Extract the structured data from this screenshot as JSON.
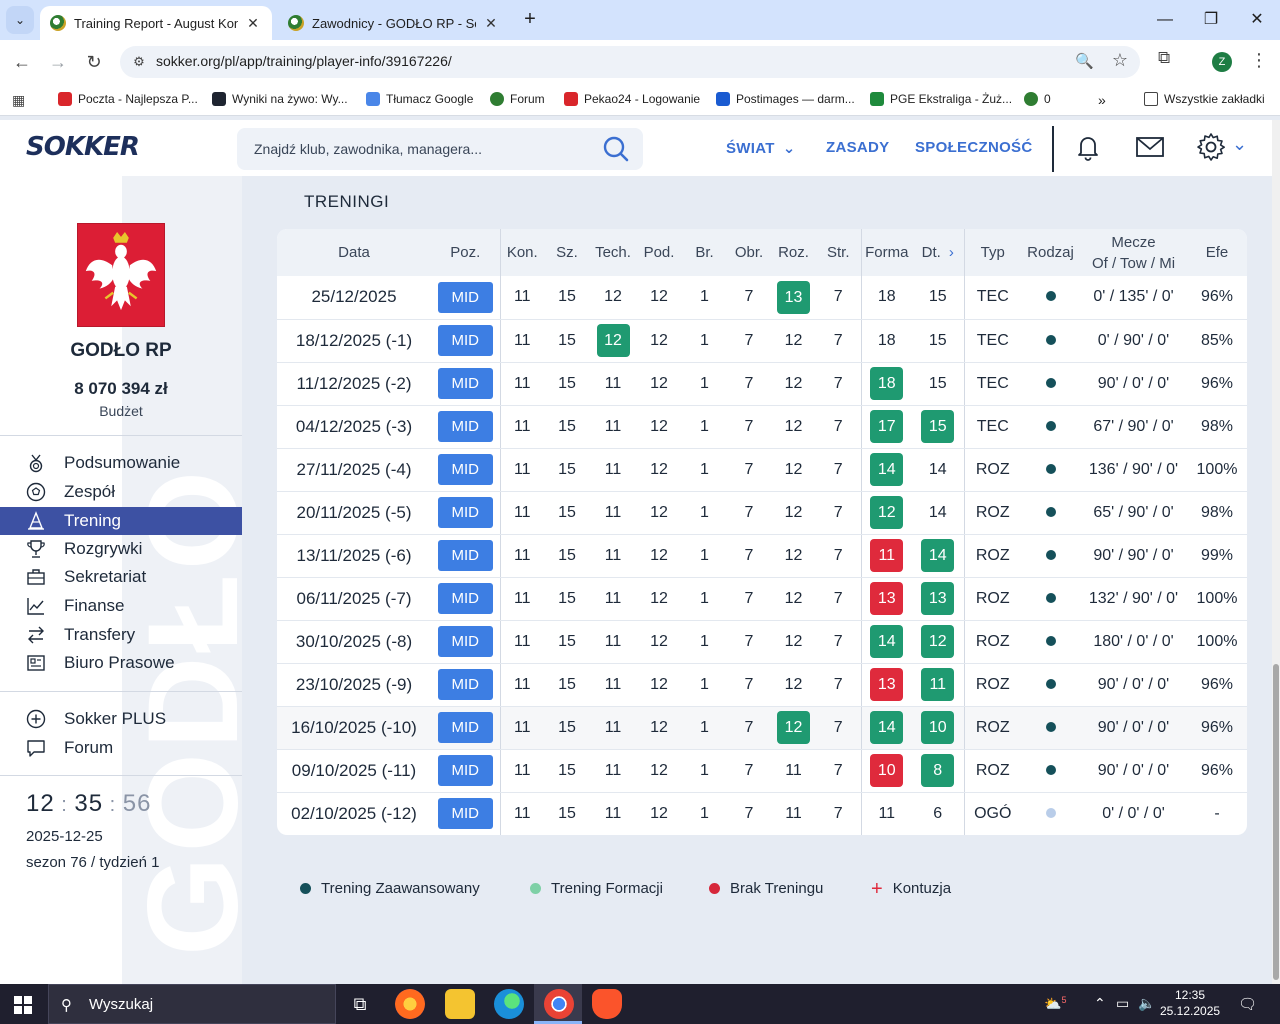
{
  "browser": {
    "tabs": [
      {
        "title": "Training Report - August Konkie",
        "active": true
      },
      {
        "title": "Zawodnicy - GODŁO RP - Sokke",
        "active": false
      }
    ],
    "url": "sokker.org/pl/app/training/player-info/39167226/",
    "profile_initial": "Z",
    "bookmarks": [
      {
        "label": "Poczta - Najlepsza P...",
        "icon": "wp-icon",
        "color": "#d9262b"
      },
      {
        "label": "Wyniki na żywo: Wy...",
        "icon": "flashscore-icon",
        "color": "#1e2430"
      },
      {
        "label": "Tłumacz Google",
        "icon": "translate-icon",
        "color": "#4a86e8"
      },
      {
        "label": "Forum",
        "icon": "ball-icon",
        "color": "#2f7d32"
      },
      {
        "label": "Pekao24 - Logowanie",
        "icon": "pekao-icon",
        "color": "#d9262b"
      },
      {
        "label": "Postimages — darm...",
        "icon": "postimages-icon",
        "color": "#1a5bd1"
      },
      {
        "label": "PGE Ekstraliga - Żuż...",
        "icon": "pge-icon",
        "color": "#1e8a3c"
      },
      {
        "label": "0",
        "icon": "ball-icon",
        "color": "#2f7d32"
      }
    ],
    "all_bookmarks_label": "Wszystkie zakładki"
  },
  "header": {
    "logo": "SOKKER",
    "search_placeholder": "Znajdź klub, zawodnika, managera...",
    "nav": [
      "ŚWIAT",
      "ZASADY",
      "SPOŁECZNOŚĆ"
    ],
    "accent_color": "#3b6fd1"
  },
  "sidebar": {
    "club_name": "GODŁO RP",
    "budget": "8 070 394 zł",
    "budget_label": "Budżet",
    "watermark": "GODŁO",
    "menu": [
      {
        "label": "Podsumowanie",
        "icon": "medal-icon",
        "active": false
      },
      {
        "label": "Zespół",
        "icon": "football-icon",
        "active": false
      },
      {
        "label": "Trening",
        "icon": "cone-icon",
        "active": true
      },
      {
        "label": "Rozgrywki",
        "icon": "trophy-icon",
        "active": false
      },
      {
        "label": "Sekretariat",
        "icon": "briefcase-icon",
        "active": false
      },
      {
        "label": "Finanse",
        "icon": "chart-icon",
        "active": false
      },
      {
        "label": "Transfery",
        "icon": "transfer-icon",
        "active": false
      },
      {
        "label": "Biuro Prasowe",
        "icon": "newspaper-icon",
        "active": false
      }
    ],
    "extra": [
      {
        "label": "Sokker PLUS",
        "icon": "plus-circle-icon"
      },
      {
        "label": "Forum",
        "icon": "chat-icon"
      }
    ],
    "clock": {
      "hh": "12",
      "mm": "35",
      "ss": "56"
    },
    "date": "2025-12-25",
    "season": "sezon 76 / tydzień 1"
  },
  "main": {
    "title": "TRENINGI",
    "columns": [
      "Data",
      "Poz.",
      "Kon.",
      "Sz.",
      "Tech.",
      "Pod.",
      "Br.",
      "Obr.",
      "Roz.",
      "Str.",
      "Forma",
      "Dt.",
      "Typ",
      "Rodzaj",
      "Mecze",
      "Of / Tow / Mi",
      "Efe"
    ],
    "rows": [
      {
        "date": "25/12/2025",
        "pos": "MID",
        "kon": "11",
        "sz": "15",
        "tech": "12",
        "pod": "12",
        "br": "1",
        "obr": "7",
        "roz": "13",
        "str": "7",
        "forma": "18",
        "dt": "15",
        "typ": "TEC",
        "rodzaj": "advanced",
        "mecze": "0' / 135' / 0'",
        "efe": "96%",
        "hl": {
          "roz": "up"
        }
      },
      {
        "date": "18/12/2025 (-1)",
        "pos": "MID",
        "kon": "11",
        "sz": "15",
        "tech": "12",
        "pod": "12",
        "br": "1",
        "obr": "7",
        "roz": "12",
        "str": "7",
        "forma": "18",
        "dt": "15",
        "typ": "TEC",
        "rodzaj": "advanced",
        "mecze": "0' / 90' / 0'",
        "efe": "85%",
        "hl": {
          "tech": "up"
        }
      },
      {
        "date": "11/12/2025 (-2)",
        "pos": "MID",
        "kon": "11",
        "sz": "15",
        "tech": "11",
        "pod": "12",
        "br": "1",
        "obr": "7",
        "roz": "12",
        "str": "7",
        "forma": "18",
        "dt": "15",
        "typ": "TEC",
        "rodzaj": "advanced",
        "mecze": "90' / 0' / 0'",
        "efe": "96%",
        "hl": {
          "forma": "up"
        }
      },
      {
        "date": "04/12/2025 (-3)",
        "pos": "MID",
        "kon": "11",
        "sz": "15",
        "tech": "11",
        "pod": "12",
        "br": "1",
        "obr": "7",
        "roz": "12",
        "str": "7",
        "forma": "17",
        "dt": "15",
        "typ": "TEC",
        "rodzaj": "advanced",
        "mecze": "67' / 90' / 0'",
        "efe": "98%",
        "hl": {
          "forma": "up",
          "dt": "up"
        }
      },
      {
        "date": "27/11/2025 (-4)",
        "pos": "MID",
        "kon": "11",
        "sz": "15",
        "tech": "11",
        "pod": "12",
        "br": "1",
        "obr": "7",
        "roz": "12",
        "str": "7",
        "forma": "14",
        "dt": "14",
        "typ": "ROZ",
        "rodzaj": "advanced",
        "mecze": "136' / 90' / 0'",
        "efe": "100%",
        "hl": {
          "forma": "up"
        }
      },
      {
        "date": "20/11/2025 (-5)",
        "pos": "MID",
        "kon": "11",
        "sz": "15",
        "tech": "11",
        "pod": "12",
        "br": "1",
        "obr": "7",
        "roz": "12",
        "str": "7",
        "forma": "12",
        "dt": "14",
        "typ": "ROZ",
        "rodzaj": "advanced",
        "mecze": "65' / 90' / 0'",
        "efe": "98%",
        "hl": {
          "forma": "up"
        }
      },
      {
        "date": "13/11/2025 (-6)",
        "pos": "MID",
        "kon": "11",
        "sz": "15",
        "tech": "11",
        "pod": "12",
        "br": "1",
        "obr": "7",
        "roz": "12",
        "str": "7",
        "forma": "11",
        "dt": "14",
        "typ": "ROZ",
        "rodzaj": "advanced",
        "mecze": "90' / 90' / 0'",
        "efe": "99%",
        "hl": {
          "forma": "down",
          "dt": "up"
        }
      },
      {
        "date": "06/11/2025 (-7)",
        "pos": "MID",
        "kon": "11",
        "sz": "15",
        "tech": "11",
        "pod": "12",
        "br": "1",
        "obr": "7",
        "roz": "12",
        "str": "7",
        "forma": "13",
        "dt": "13",
        "typ": "ROZ",
        "rodzaj": "advanced",
        "mecze": "132' / 90' / 0'",
        "efe": "100%",
        "hl": {
          "forma": "down",
          "dt": "up"
        }
      },
      {
        "date": "30/10/2025 (-8)",
        "pos": "MID",
        "kon": "11",
        "sz": "15",
        "tech": "11",
        "pod": "12",
        "br": "1",
        "obr": "7",
        "roz": "12",
        "str": "7",
        "forma": "14",
        "dt": "12",
        "typ": "ROZ",
        "rodzaj": "advanced",
        "mecze": "180' / 0' / 0'",
        "efe": "100%",
        "hl": {
          "forma": "up",
          "dt": "up"
        }
      },
      {
        "date": "23/10/2025 (-9)",
        "pos": "MID",
        "kon": "11",
        "sz": "15",
        "tech": "11",
        "pod": "12",
        "br": "1",
        "obr": "7",
        "roz": "12",
        "str": "7",
        "forma": "13",
        "dt": "11",
        "typ": "ROZ",
        "rodzaj": "advanced",
        "mecze": "90' / 0' / 0'",
        "efe": "96%",
        "hl": {
          "forma": "down",
          "dt": "up"
        }
      },
      {
        "date": "16/10/2025 (-10)",
        "pos": "MID",
        "kon": "11",
        "sz": "15",
        "tech": "11",
        "pod": "12",
        "br": "1",
        "obr": "7",
        "roz": "12",
        "str": "7",
        "forma": "14",
        "dt": "10",
        "typ": "ROZ",
        "rodzaj": "advanced",
        "mecze": "90' / 0' / 0'",
        "efe": "96%",
        "hl": {
          "roz": "up",
          "forma": "up",
          "dt": "up"
        },
        "hover": true
      },
      {
        "date": "09/10/2025 (-11)",
        "pos": "MID",
        "kon": "11",
        "sz": "15",
        "tech": "11",
        "pod": "12",
        "br": "1",
        "obr": "7",
        "roz": "11",
        "str": "7",
        "forma": "10",
        "dt": "8",
        "typ": "ROZ",
        "rodzaj": "advanced",
        "mecze": "90' / 0' / 0'",
        "efe": "96%",
        "hl": {
          "forma": "down",
          "dt": "up"
        }
      },
      {
        "date": "02/10/2025 (-12)",
        "pos": "MID",
        "kon": "11",
        "sz": "15",
        "tech": "11",
        "pod": "12",
        "br": "1",
        "obr": "7",
        "roz": "11",
        "str": "7",
        "forma": "11",
        "dt": "6",
        "typ": "OGÓ",
        "rodzaj": "formation",
        "mecze": "0' / 0' / 0'",
        "efe": "-",
        "hl": {}
      }
    ],
    "legend": [
      {
        "label": "Trening Zaawansowany",
        "kind": "dot",
        "color": "#15505a"
      },
      {
        "label": "Trening Formacji",
        "kind": "dot",
        "color": "#7ed0a6"
      },
      {
        "label": "Brak Treningu",
        "kind": "dot",
        "color": "#d6273a"
      },
      {
        "label": "Kontuzja",
        "kind": "plus",
        "color": "#df2a3c"
      }
    ],
    "colors": {
      "up": "#1f9a71",
      "down": "#df2a3c",
      "advanced_dot": "#15505a",
      "formation_dot": "#b9cde9",
      "badge": "#3d7ee3"
    }
  },
  "taskbar": {
    "search_label": "Wyszukaj",
    "time": "12:35",
    "date": "25.12.2025",
    "weather_badge": "5"
  }
}
